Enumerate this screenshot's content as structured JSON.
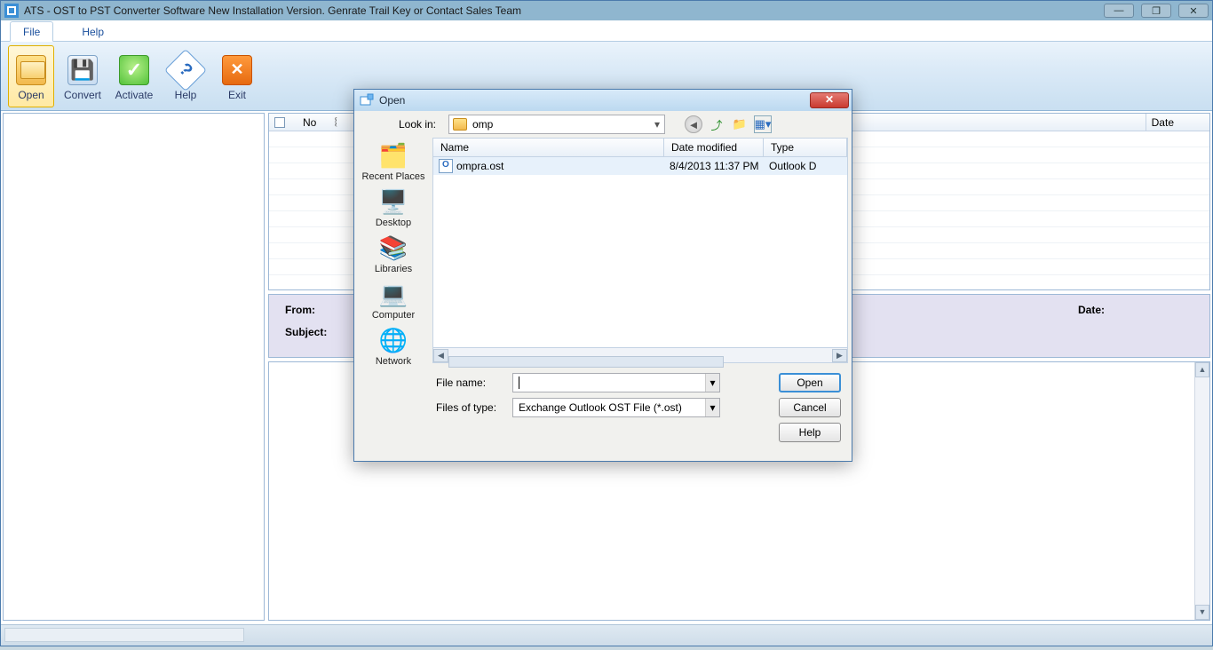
{
  "app": {
    "title": "ATS - OST to PST Converter Software New Installation Version. Genrate Trail Key or Contact Sales Team"
  },
  "menubar": {
    "file": "File",
    "help": "Help"
  },
  "ribbon": {
    "open": "Open",
    "convert": "Convert",
    "activate": "Activate",
    "help": "Help",
    "exit": "Exit"
  },
  "list": {
    "no": "No",
    "date": "Date"
  },
  "meta": {
    "from": "From:",
    "subject": "Subject:",
    "date": "Date:"
  },
  "dialog": {
    "title": "Open",
    "lookin_label": "Look in:",
    "lookin_value": "omp",
    "cols": {
      "name": "Name",
      "date": "Date modified",
      "type": "Type"
    },
    "files": [
      {
        "name": "ompra.ost",
        "date": "8/4/2013 11:37 PM",
        "type": "Outlook D"
      }
    ],
    "filename_label": "File name:",
    "filename_value": "",
    "filetype_label": "Files of type:",
    "filetype_value": "Exchange Outlook OST File (*.ost)",
    "open_btn": "Open",
    "cancel_btn": "Cancel",
    "help_btn": "Help",
    "places": {
      "recent": "Recent Places",
      "desktop": "Desktop",
      "libraries": "Libraries",
      "computer": "Computer",
      "network": "Network"
    }
  }
}
